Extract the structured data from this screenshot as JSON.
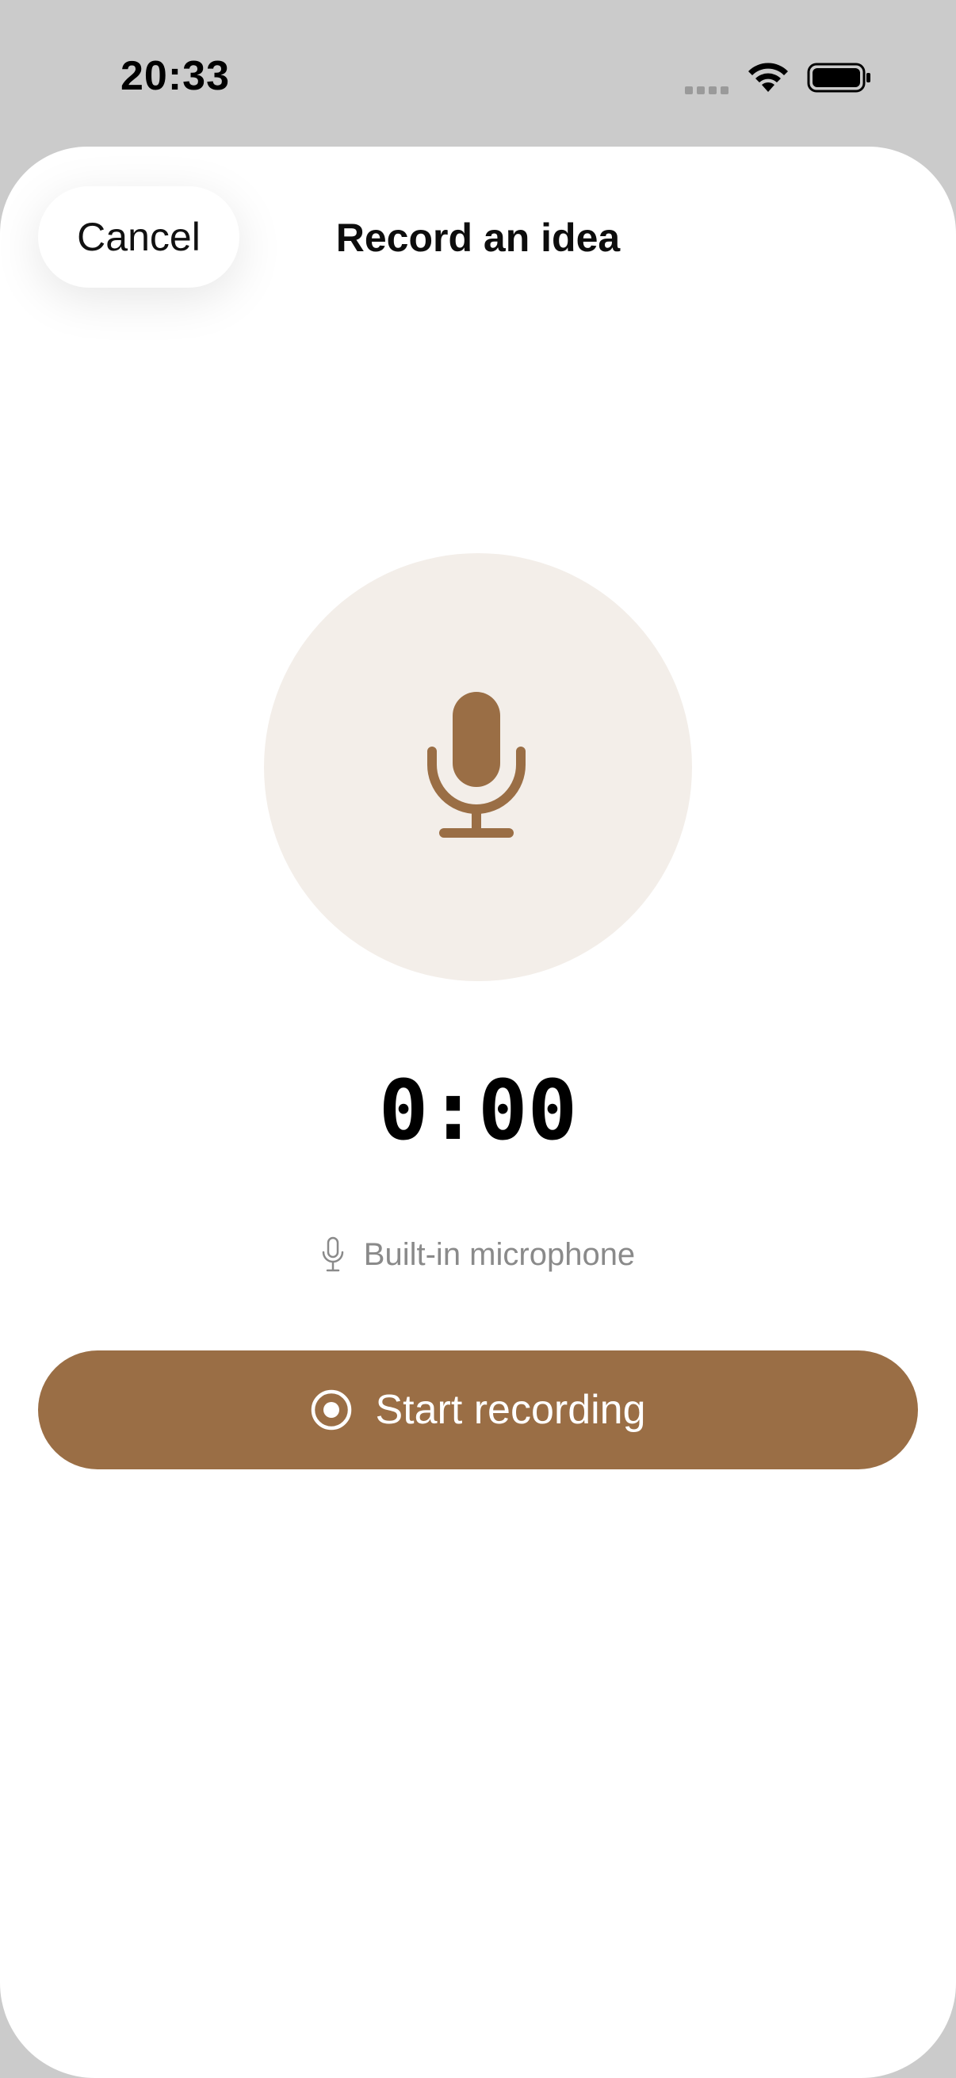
{
  "status_bar": {
    "time": "20:33"
  },
  "sheet": {
    "title": "Record an idea",
    "cancel_label": "Cancel"
  },
  "recorder": {
    "timer": "0:00",
    "input_source": "Built-in microphone",
    "start_label": "Start recording"
  },
  "icons": {
    "mic": "microphone-icon",
    "small_mic": "microphone-small-icon",
    "record": "record-icon",
    "wifi": "wifi-icon",
    "battery": "battery-icon"
  },
  "colors": {
    "accent": "#9a6e45",
    "mic_circle_bg": "#f3eee9",
    "mic_icon": "#9a6e45"
  }
}
